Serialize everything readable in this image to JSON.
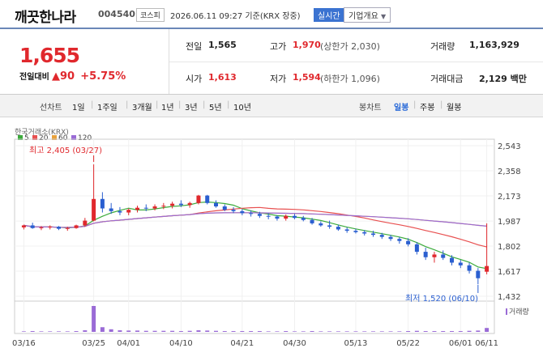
{
  "header": {
    "name": "깨끗한나라",
    "code": "004540",
    "market": "코스피",
    "datetime": "2026.06.11 09:27 기준(KRX 장중)",
    "live": "실시간",
    "info_btn": "기업개요"
  },
  "quote": {
    "price": "1,655",
    "change_label": "전일대비",
    "change": "▲90",
    "change_pct": "+5.75%",
    "prev_label": "전일",
    "prev": "1,565",
    "open_label": "시가",
    "open": "1,613",
    "high_label": "고가",
    "high": "1,970",
    "high_limit": "(상한가 2,030)",
    "low_label": "저가",
    "low": "1,594",
    "low_limit": "(하한가 1,096)",
    "vol_label": "거래량",
    "vol": "1,163,929",
    "amt_label": "거래대금",
    "amt": "2,129 백만"
  },
  "toolbar": {
    "line_label": "선차트",
    "line_opts": [
      "1일",
      "1주일",
      "3개월",
      "1년",
      "3년",
      "5년",
      "10년"
    ],
    "candle_label": "봉차트",
    "candle_opts": [
      "일봉",
      "주봉",
      "월봉"
    ],
    "active_candle": "일봉"
  },
  "chart_data": {
    "type": "candlestick",
    "source": "한국거래소(KRX)",
    "ma_legend": [
      {
        "name": "5",
        "color": "#3cab3c"
      },
      {
        "name": "20",
        "color": "#e85050"
      },
      {
        "name": "60",
        "color": "#e8a13c"
      },
      {
        "name": "120",
        "color": "#9a6bd6"
      }
    ],
    "y_ticks": [
      "2,543",
      "2,358",
      "2,173",
      "1,987",
      "1,802",
      "1,617",
      "1,432"
    ],
    "ylim": [
      1432,
      2543
    ],
    "x_ticks": [
      "03/16",
      "03/25",
      "04/01",
      "04/10",
      "04/21",
      "04/30",
      "05/13",
      "05/22",
      "06/01",
      "06/11"
    ],
    "high_annotation": "최고 2,405 (03/27)",
    "low_annotation": "최저 1,520 (06/10)",
    "volume_label": "거래량",
    "candles": [
      [
        1940,
        1960,
        1925,
        1955
      ],
      [
        1955,
        1975,
        1930,
        1935
      ],
      [
        1935,
        1950,
        1920,
        1940
      ],
      [
        1940,
        1955,
        1925,
        1945
      ],
      [
        1945,
        1950,
        1920,
        1930
      ],
      [
        1930,
        1945,
        1915,
        1935
      ],
      [
        1935,
        1960,
        1930,
        1955
      ],
      [
        1955,
        2010,
        1945,
        1990
      ],
      [
        1990,
        2405,
        1985,
        2150
      ],
      [
        2150,
        2200,
        2050,
        2080
      ],
      [
        2080,
        2120,
        2040,
        2060
      ],
      [
        2060,
        2090,
        2030,
        2050
      ],
      [
        2050,
        2080,
        2030,
        2070
      ],
      [
        2070,
        2100,
        2050,
        2085
      ],
      [
        2085,
        2110,
        2060,
        2080
      ],
      [
        2080,
        2110,
        2065,
        2095
      ],
      [
        2095,
        2120,
        2075,
        2100
      ],
      [
        2100,
        2130,
        2080,
        2115
      ],
      [
        2115,
        2140,
        2090,
        2105
      ],
      [
        2105,
        2130,
        2085,
        2120
      ],
      [
        2120,
        2180,
        2110,
        2175
      ],
      [
        2175,
        2180,
        2110,
        2120
      ],
      [
        2120,
        2140,
        2085,
        2095
      ],
      [
        2095,
        2110,
        2060,
        2070
      ],
      [
        2070,
        2090,
        2045,
        2060
      ],
      [
        2060,
        2075,
        2030,
        2045
      ],
      [
        2045,
        2065,
        2020,
        2040
      ],
      [
        2040,
        2055,
        2010,
        2025
      ],
      [
        2025,
        2045,
        2000,
        2020
      ],
      [
        2020,
        2030,
        1990,
        2005
      ],
      [
        2005,
        2035,
        1990,
        2025
      ],
      [
        2025,
        2040,
        2000,
        2010
      ],
      [
        2010,
        2025,
        1985,
        1995
      ],
      [
        1995,
        2010,
        1960,
        1970
      ],
      [
        1970,
        1985,
        1945,
        1955
      ],
      [
        1955,
        1990,
        1930,
        1945
      ],
      [
        1945,
        1960,
        1915,
        1925
      ],
      [
        1925,
        1940,
        1900,
        1915
      ],
      [
        1915,
        1930,
        1895,
        1905
      ],
      [
        1905,
        1920,
        1880,
        1895
      ],
      [
        1895,
        1915,
        1870,
        1885
      ],
      [
        1885,
        1900,
        1855,
        1870
      ],
      [
        1870,
        1885,
        1840,
        1855
      ],
      [
        1855,
        1870,
        1820,
        1840
      ],
      [
        1840,
        1860,
        1800,
        1815
      ],
      [
        1815,
        1830,
        1740,
        1760
      ],
      [
        1760,
        1790,
        1700,
        1720
      ],
      [
        1720,
        1760,
        1680,
        1740
      ],
      [
        1740,
        1770,
        1700,
        1715
      ],
      [
        1715,
        1735,
        1660,
        1680
      ],
      [
        1680,
        1700,
        1640,
        1660
      ],
      [
        1660,
        1680,
        1600,
        1620
      ],
      [
        1620,
        1640,
        1520,
        1565
      ],
      [
        1613,
        1970,
        1594,
        1655
      ]
    ],
    "volumes": [
      0.02,
      0.03,
      0.02,
      0.02,
      0.02,
      0.02,
      0.03,
      0.06,
      1.0,
      0.18,
      0.1,
      0.06,
      0.05,
      0.05,
      0.04,
      0.04,
      0.04,
      0.04,
      0.03,
      0.04,
      0.06,
      0.05,
      0.04,
      0.03,
      0.03,
      0.03,
      0.03,
      0.03,
      0.02,
      0.02,
      0.03,
      0.02,
      0.02,
      0.03,
      0.02,
      0.02,
      0.02,
      0.02,
      0.02,
      0.02,
      0.02,
      0.02,
      0.02,
      0.02,
      0.03,
      0.04,
      0.03,
      0.03,
      0.03,
      0.03,
      0.03,
      0.04,
      0.05,
      0.15
    ]
  }
}
